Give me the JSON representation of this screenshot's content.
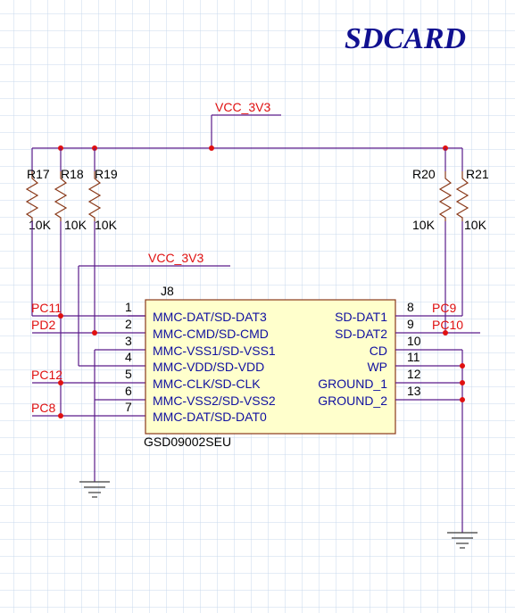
{
  "title": "SDCARD",
  "power_nets": {
    "top": "VCC_3V3",
    "mid": "VCC_3V3"
  },
  "resistors": [
    {
      "ref": "R17",
      "value": "10K"
    },
    {
      "ref": "R18",
      "value": "10K"
    },
    {
      "ref": "R19",
      "value": "10K"
    },
    {
      "ref": "R20",
      "value": "10K"
    },
    {
      "ref": "R21",
      "value": "10K"
    }
  ],
  "connector": {
    "ref": "J8",
    "part": "GSD09002SEU"
  },
  "left_pins": [
    {
      "num": "1",
      "name": "MMC-DAT/SD-DAT3"
    },
    {
      "num": "2",
      "name": "MMC-CMD/SD-CMD"
    },
    {
      "num": "3",
      "name": "MMC-VSS1/SD-VSS1"
    },
    {
      "num": "4",
      "name": "MMC-VDD/SD-VDD"
    },
    {
      "num": "5",
      "name": "MMC-CLK/SD-CLK"
    },
    {
      "num": "6",
      "name": "MMC-VSS2/SD-VSS2"
    },
    {
      "num": "7",
      "name": "MMC-DAT/SD-DAT0"
    }
  ],
  "left_pin_numbers_display": [
    "1",
    "2",
    "3",
    "4",
    "5",
    "6",
    "7"
  ],
  "right_pins": [
    {
      "num": "8",
      "name": "SD-DAT1"
    },
    {
      "num": "9",
      "name": "SD-DAT2"
    },
    {
      "num": "10",
      "name": "CD"
    },
    {
      "num": "11",
      "name": "WP"
    },
    {
      "num": "12",
      "name": "GROUND_1"
    },
    {
      "num": "13",
      "name": "GROUND_2"
    }
  ],
  "net_labels": {
    "pc11": "PC11",
    "pd2": "PD2",
    "pc12": "PC12",
    "pc8": "PC8",
    "pc9": "PC9",
    "pc10": "PC10"
  },
  "colors": {
    "grid": "#c8d8ec",
    "wire": "#5a1a8a",
    "junction": "#e01010",
    "pin_name": "#1010a0",
    "net_label": "#e01010",
    "title": "#101090",
    "body_fill": "#ffffcc"
  }
}
